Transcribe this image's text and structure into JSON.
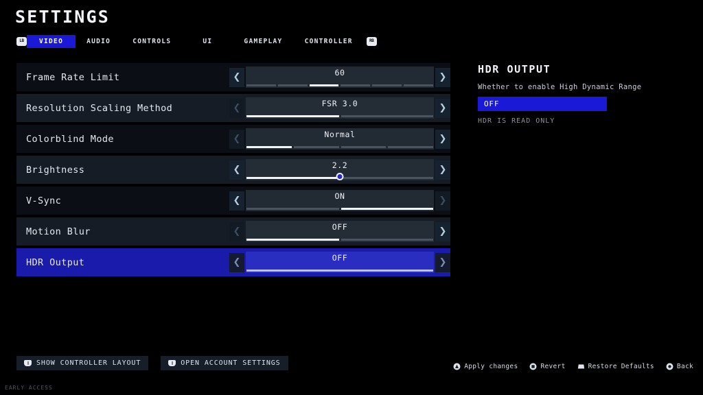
{
  "header": {
    "title": "SETTINGS"
  },
  "tabs": {
    "left_bumper_icon": "LB",
    "right_bumper_icon": "RB",
    "items": [
      {
        "label": "VIDEO",
        "active": true
      },
      {
        "label": "AUDIO",
        "active": false
      },
      {
        "label": "CONTROLS",
        "active": false
      },
      {
        "label": "UI",
        "active": false
      },
      {
        "label": "GAMEPLAY",
        "active": false
      },
      {
        "label": "CONTROLLER",
        "active": false
      }
    ]
  },
  "settings": {
    "rows": [
      {
        "label": "Frame Rate Limit",
        "value": "60",
        "widget": "segments",
        "segments": 6,
        "active_index": 2,
        "left_enabled": true,
        "right_enabled": true,
        "selected": false
      },
      {
        "label": "Resolution Scaling Method",
        "value": "FSR 3.0",
        "widget": "segments",
        "segments": 2,
        "active_index": 0,
        "left_enabled": false,
        "right_enabled": true,
        "selected": false
      },
      {
        "label": "Colorblind Mode",
        "value": "Normal",
        "widget": "segments",
        "segments": 4,
        "active_index": 0,
        "left_enabled": false,
        "right_enabled": true,
        "selected": false
      },
      {
        "label": "Brightness",
        "value": "2.2",
        "widget": "slider",
        "fill_percent": 50,
        "left_enabled": true,
        "right_enabled": true,
        "selected": false
      },
      {
        "label": "V-Sync",
        "value": "ON",
        "widget": "segments",
        "segments": 2,
        "active_index": 1,
        "left_enabled": true,
        "right_enabled": false,
        "selected": false
      },
      {
        "label": "Motion Blur",
        "value": "OFF",
        "widget": "segments",
        "segments": 2,
        "active_index": 0,
        "left_enabled": false,
        "right_enabled": true,
        "selected": false
      },
      {
        "label": "HDR Output",
        "value": "OFF",
        "widget": "segments",
        "segments": 1,
        "active_index": 0,
        "left_enabled": false,
        "right_enabled": false,
        "selected": true
      }
    ]
  },
  "detail": {
    "title": "HDR OUTPUT",
    "description": "Whether to enable High Dynamic Range",
    "value": "OFF",
    "note": "HDR IS READ ONLY"
  },
  "bottom_buttons": [
    {
      "label": "SHOW CONTROLLER LAYOUT",
      "icon": "gamepad-icon"
    },
    {
      "label": "OPEN ACCOUNT SETTINGS",
      "icon": "gamepad-icon"
    }
  ],
  "hints": [
    {
      "label": "Apply changes",
      "icon": "button-a-icon"
    },
    {
      "label": "Revert",
      "icon": "button-circle-icon"
    },
    {
      "label": "Restore Defaults",
      "icon": "touchpad-icon"
    },
    {
      "label": "Back",
      "icon": "button-back-icon"
    }
  ],
  "footer": {
    "early_access": "EARLY ACCESS"
  },
  "colors": {
    "accent_blue": "#1a1ad6",
    "selected_row": "#1a1aab",
    "background": "#000000",
    "row_dark": "#0b0f15",
    "row_light": "#161c26",
    "slider_knob": "#2727d8"
  }
}
